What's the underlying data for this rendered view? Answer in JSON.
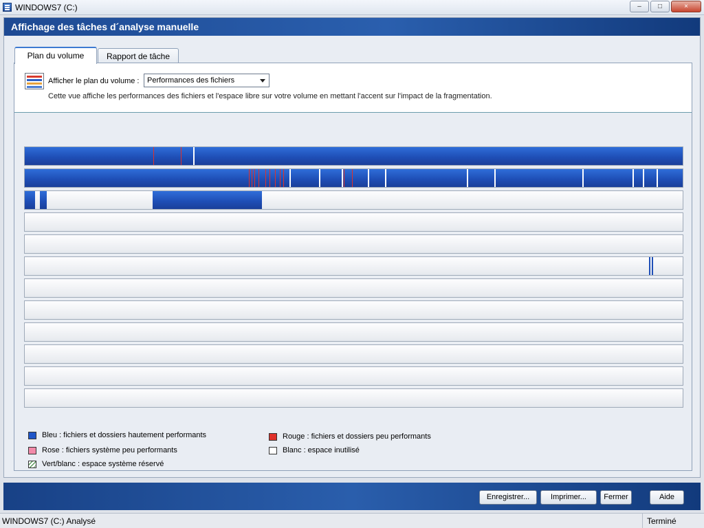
{
  "window": {
    "title": "WINDOWS7 (C:)",
    "controls": [
      "–",
      "□",
      "×"
    ]
  },
  "header": {
    "title": "Affichage des tâches d´analyse manuelle"
  },
  "tabs": [
    {
      "label": "Plan du volume",
      "active": true
    },
    {
      "label": "Rapport de tâche",
      "active": false
    }
  ],
  "map_options": {
    "label": "Afficher le plan du volume :",
    "selected": "Performances des fichiers",
    "description": "Cette vue affiche les performances des fichiers et l'espace libre sur votre volume en mettant l'accent sur l'impact de la fragmentation."
  },
  "legend": [
    {
      "label": "Bleu : fichiers et dossiers hautement performants",
      "color": "#1f55c8"
    },
    {
      "label": "Rouge : fichiers et dossiers peu performants",
      "color": "#e0312a"
    },
    {
      "label": "Rose : fichiers système peu performants",
      "color": "#f28aa9"
    },
    {
      "label": "Blanc : espace inutilisé",
      "color": "#ffffff"
    },
    {
      "label": "Vert/blanc : espace système réservé",
      "color": "hatched"
    }
  ],
  "buttons": {
    "save": "Enregistrer...",
    "print": "Imprimer...",
    "close": "Fermer",
    "help": "Aide"
  },
  "status": {
    "left": "WINDOWS7 (C:) Analysé",
    "right": "Terminé"
  },
  "colors": {
    "blue": "#1f55c8",
    "red": "#e0312a",
    "accent": "#2a5fae"
  }
}
